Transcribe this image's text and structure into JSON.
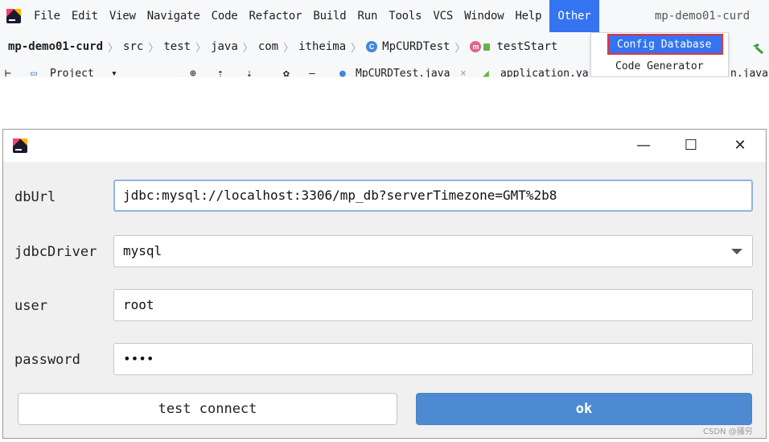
{
  "ide": {
    "menu": [
      "File",
      "Edit",
      "View",
      "Navigate",
      "Code",
      "Refactor",
      "Build",
      "Run",
      "Tools",
      "VCS",
      "Window",
      "Help",
      "Other"
    ],
    "active_menu": "Other",
    "project_name_top": "mp-demo01-curd",
    "breadcrumb": {
      "project": "mp-demo01-curd",
      "parts": [
        "src",
        "test",
        "java",
        "com",
        "itheima"
      ],
      "class_name": "MpCURDTest",
      "method_name": "testStart"
    },
    "toolbar": {
      "project_label": "Project",
      "tab1": "MpCURDTest.java",
      "tab2": "application.ya",
      "tab3": "n.java"
    },
    "dropdown": {
      "items": [
        "Config Database",
        "Code Generator"
      ],
      "selected": "Config Database"
    }
  },
  "dialog": {
    "title": "",
    "fields": {
      "dbUrl": {
        "label": "dbUrl",
        "value": "jdbc:mysql://localhost:3306/mp_db?serverTimezone=GMT%2b8"
      },
      "jdbcDriver": {
        "label": "jdbcDriver",
        "value": "mysql"
      },
      "user": {
        "label": "user",
        "value": "root"
      },
      "password": {
        "label": "password",
        "value": "••••"
      }
    },
    "buttons": {
      "test_connect": "test connect",
      "ok": "ok"
    }
  },
  "watermark": "CSDN @骚穷",
  "colors": {
    "accent": "#3574f0",
    "ok_button": "#4e8ad1",
    "highlight_border": "#e8323c"
  }
}
